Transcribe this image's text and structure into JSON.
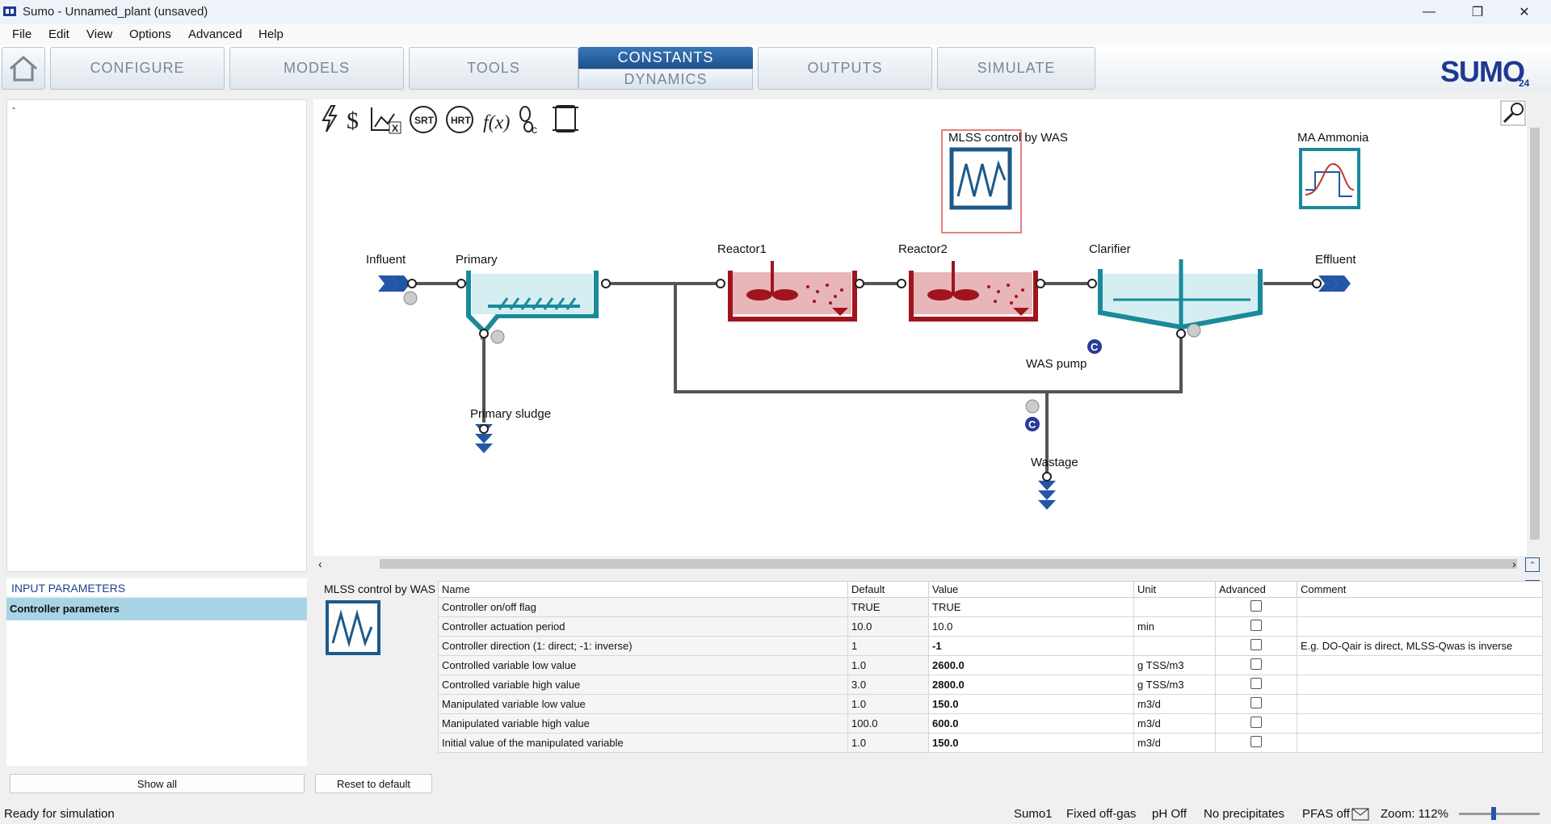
{
  "window": {
    "title": "Sumo - Unnamed_plant (unsaved)",
    "minimize": "—",
    "restore": "❐",
    "close": "✕"
  },
  "menu": [
    "File",
    "Edit",
    "View",
    "Options",
    "Advanced",
    "Help"
  ],
  "nav": {
    "tabs": [
      "CONFIGURE",
      "MODELS",
      "TOOLS",
      "OUTPUTS",
      "SIMULATE"
    ],
    "active_top": "CONSTANTS",
    "active_bottom": "DYNAMICS",
    "logo": "SUMO",
    "logo_version": "24"
  },
  "left_panel": {
    "item": "-"
  },
  "diagram": {
    "labels": {
      "influent": "Influent",
      "primary": "Primary",
      "reactor1": "Reactor1",
      "reactor2": "Reactor2",
      "clarifier": "Clarifier",
      "effluent": "Effluent",
      "primary_sludge": "Primary sludge",
      "was_pump": "WAS pump",
      "wastage": "Wastage",
      "mlss_control": "MLSS control by WAS",
      "ma_ammonia": "MA Ammonia"
    },
    "controller_badge": "C",
    "toolbar": [
      "lightning-icon",
      "dollar-icon",
      "excel-icon",
      "srt-icon",
      "hrt-icon",
      "function-icon",
      "footprint-icon",
      "scroll-icon"
    ],
    "toolbar_text": {
      "dollar": "$",
      "srt": "SRT",
      "hrt": "HRT",
      "function": "f(x)"
    }
  },
  "input_parameters": {
    "header": "INPUT PARAMETERS",
    "selected_group": "Controller parameters",
    "show_all": "Show all",
    "reset": "Reset to default",
    "block_title": "MLSS control by WAS"
  },
  "table": {
    "columns": {
      "name": "Name",
      "default": "Default",
      "value": "Value",
      "unit": "Unit",
      "advanced": "Advanced",
      "comment": "Comment"
    },
    "rows": [
      {
        "name": "Controller on/off flag",
        "default": "TRUE",
        "value": "TRUE",
        "unit": "",
        "comment": ""
      },
      {
        "name": "Controller actuation period",
        "default": "10.0",
        "value": "10.0",
        "unit": "min",
        "comment": ""
      },
      {
        "name": "Controller direction (1: direct; -1: inverse)",
        "default": "1",
        "value": "-1",
        "unit": "",
        "comment": "E.g. DO-Qair is direct, MLSS-Qwas is inverse"
      },
      {
        "name": "Controlled variable low value",
        "default": "1.0",
        "value": "2600.0",
        "unit": "g TSS/m3",
        "comment": ""
      },
      {
        "name": "Controlled variable high value",
        "default": "3.0",
        "value": "2800.0",
        "unit": "g TSS/m3",
        "comment": ""
      },
      {
        "name": "Manipulated variable low value",
        "default": "1.0",
        "value": "150.0",
        "unit": "m3/d",
        "comment": ""
      },
      {
        "name": "Manipulated variable high value",
        "default": "100.0",
        "value": "600.0",
        "unit": "m3/d",
        "comment": ""
      },
      {
        "name": "Initial value of the manipulated variable",
        "default": "1.0",
        "value": "150.0",
        "unit": "m3/d",
        "comment": ""
      }
    ]
  },
  "status": {
    "left": "Ready for simulation",
    "model": "Sumo1",
    "offgas": "Fixed off-gas",
    "ph": "pH Off",
    "precip": "No precipitates",
    "pfas": "PFAS off",
    "zoom": "Zoom: 112%"
  },
  "colors": {
    "teal": "#1a8a9a",
    "red": "#a0141e",
    "navy": "#1d3a8f",
    "accent_blue": "#2c5ea8"
  }
}
